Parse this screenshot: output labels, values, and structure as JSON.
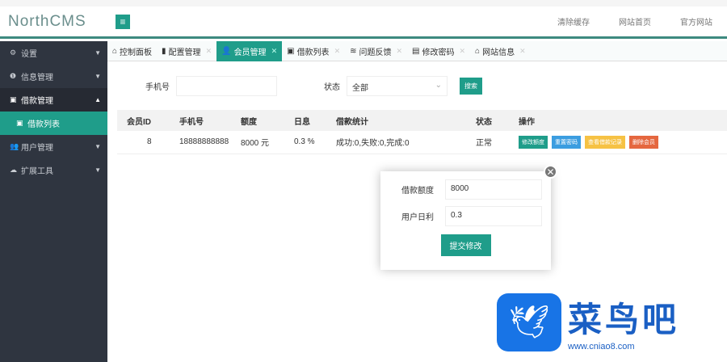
{
  "header": {
    "logo": "NorthCMS",
    "menu_icon": "≡",
    "links": [
      "清除缓存",
      "网站首页",
      "官方网站"
    ]
  },
  "sidebar": {
    "items": [
      {
        "label": "设置",
        "icon": "⚙"
      },
      {
        "label": "信息管理",
        "icon": "❶"
      },
      {
        "label": "借款管理",
        "icon": "▣"
      },
      {
        "label": "借款列表",
        "icon": "▣"
      },
      {
        "label": "用户管理",
        "icon": "👥"
      },
      {
        "label": "扩展工具",
        "icon": "☁"
      }
    ]
  },
  "tabs": [
    {
      "label": "控制面板",
      "icon": "⌂"
    },
    {
      "label": "配置管理",
      "icon": "▮"
    },
    {
      "label": "会员管理",
      "icon": "👤"
    },
    {
      "label": "借款列表",
      "icon": "▣"
    },
    {
      "label": "问题反馈",
      "icon": "≋"
    },
    {
      "label": "修改密码",
      "icon": "▤"
    },
    {
      "label": "网站信息",
      "icon": "⌂"
    }
  ],
  "search": {
    "phone_label": "手机号",
    "phone_value": "",
    "status_label": "状态",
    "status_value": "全部",
    "button": "搜索"
  },
  "table": {
    "headers": [
      "会员ID",
      "手机号",
      "额度",
      "日息",
      "借款统计",
      "状态",
      "操作"
    ],
    "rows": [
      {
        "id": "8",
        "phone": "18888888888",
        "limit": "8000 元",
        "rate": "0.3 %",
        "stats": "成功:0,失败:0,完成:0",
        "status": "正常",
        "actions": [
          "修改额度",
          "重置密码",
          "查看借款记录",
          "删除会员"
        ]
      }
    ]
  },
  "modal": {
    "limit_label": "借款额度",
    "limit_value": "8000",
    "rate_label": "用户日利",
    "rate_value": "0.3",
    "submit": "提交修改"
  },
  "watermark": {
    "text": "菜鸟吧",
    "url": "www.cniao8.com"
  }
}
